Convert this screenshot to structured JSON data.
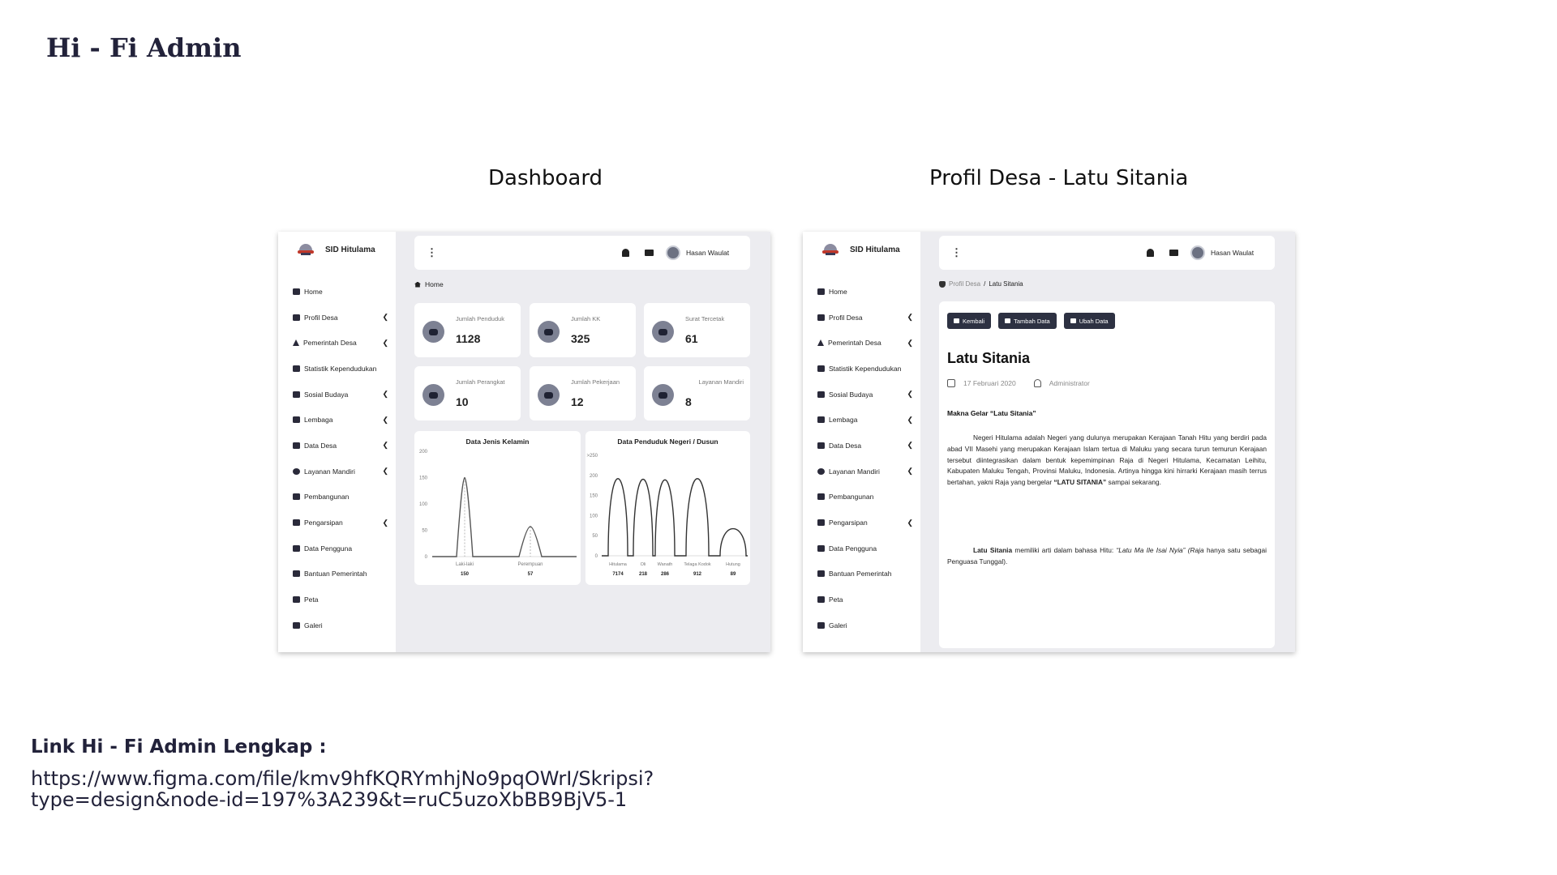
{
  "slide": {
    "title": "Hi - Fi Admin",
    "caption_dashboard": "Dashboard",
    "caption_profil": "Profil Desa - Latu Sitania",
    "link_title": "Link Hi - Fi Admin Lengkap :",
    "link_url_1": "https://www.figma.com/file/kmv9hfKQRYmhjNo9pqOWrI/Skripsi?",
    "link_url_2": "type=design&node-id=197%3A239&t=ruC5uzoXbBB9BjV5-1"
  },
  "app": {
    "brand": "SID Hitulama",
    "user": "Hasan Waulat",
    "nav": [
      {
        "label": "Home",
        "icon": "home-icon",
        "chevron": ""
      },
      {
        "label": "Profil Desa",
        "icon": "shield-icon",
        "chevron": "❮"
      },
      {
        "label": "Pemerintah Desa",
        "icon": "warning-icon",
        "chevron": "❮"
      },
      {
        "label": "Statistik Kependudukan",
        "icon": "chart-icon",
        "chevron": ""
      },
      {
        "label": "Sosial Budaya",
        "icon": "sync-icon",
        "chevron": "❮"
      },
      {
        "label": "Lembaga",
        "icon": "book-icon",
        "chevron": "❮"
      },
      {
        "label": "Data Desa",
        "icon": "list-icon",
        "chevron": "❮"
      },
      {
        "label": "Layanan Mandiri",
        "icon": "service-icon",
        "chevron": "❮"
      },
      {
        "label": "Pembangunan",
        "icon": "building-icon",
        "chevron": ""
      },
      {
        "label": "Pengarsipan",
        "icon": "archive-icon",
        "chevron": "❮"
      },
      {
        "label": "Data Pengguna",
        "icon": "users-icon",
        "chevron": ""
      },
      {
        "label": "Bantuan Pemerintah",
        "icon": "hand-icon",
        "chevron": ""
      },
      {
        "label": "Peta",
        "icon": "map-icon",
        "chevron": ""
      },
      {
        "label": "Galeri",
        "icon": "gallery-icon",
        "chevron": ""
      }
    ]
  },
  "dashboard": {
    "breadcrumb": "Home",
    "stats": [
      {
        "label": "Jumlah Penduduk",
        "value": "1128"
      },
      {
        "label": "Jumlah KK",
        "value": "325"
      },
      {
        "label": "Surat Tercetak",
        "value": "61"
      },
      {
        "label": "Jumlah Perangkat",
        "value": "10"
      },
      {
        "label": "Jumlah Pekerjaan",
        "value": "12"
      },
      {
        "label": "Layanan Mandiri",
        "value": "8"
      }
    ]
  },
  "profil": {
    "breadcrumb_parent": "Profil Desa",
    "breadcrumb_sep": "/",
    "breadcrumb_current": "Latu Sitania",
    "btn_back": "Kembali",
    "btn_add": "Tambah Data",
    "btn_edit": "Ubah Data",
    "title": "Latu Sitania",
    "date": "17 Februari 2020",
    "author": "Administrator",
    "section_title": "Makna Gelar “Latu Sitania”",
    "p1": "Negeri Hitulama adalah Negeri yang dulunya merupakan Kerajaan Tanah Hitu yang berdiri pada abad VII Masehi yang merupakan Kerajaan Islam tertua di Maluku yang secara turun temurun Kerajaan tersebut diintegrasikan dalam bentuk kepemimpinan Raja di Negeri Hitulama, Kecamatan Leihitu, Kabupaten Maluku Tengah, Provinsi Maluku, Indonesia. Artinya hingga kini hirrarki Kerajaan masih terrus bertahan, yakni Raja yang bergelar ",
    "p1_bold": "“LATU SITANIA”",
    "p1_end": " sampai sekarang.",
    "p2_bold": "Latu Sitania",
    "p2": " memiliki arti dalam bahasa Hitu: ",
    "p2_italic": "“Latu Ma Ile Isai Nyia” (Raja",
    "p2_end": " hanya satu sebagai Penguasa Tunggal)."
  },
  "chart_data": [
    {
      "type": "area",
      "title": "Data Jenis Kelamin",
      "categories": [
        "Laki-laki",
        "Perempuan"
      ],
      "values": [
        150,
        57
      ],
      "ylim": [
        0,
        200
      ],
      "yticks": [
        0,
        50,
        100,
        150,
        200
      ],
      "color": "#555555"
    },
    {
      "type": "line",
      "title": "Data Penduduk Negeri / Dusun",
      "categories": [
        "Hitulama",
        "Oli",
        "Wanath",
        "Telaga Kodok",
        "Hutung"
      ],
      "values": [
        7174,
        218,
        286,
        912,
        89
      ],
      "yticks": [
        0,
        50,
        100,
        150,
        200
      ],
      "ytop_label": ">250",
      "color": "#333333"
    }
  ]
}
